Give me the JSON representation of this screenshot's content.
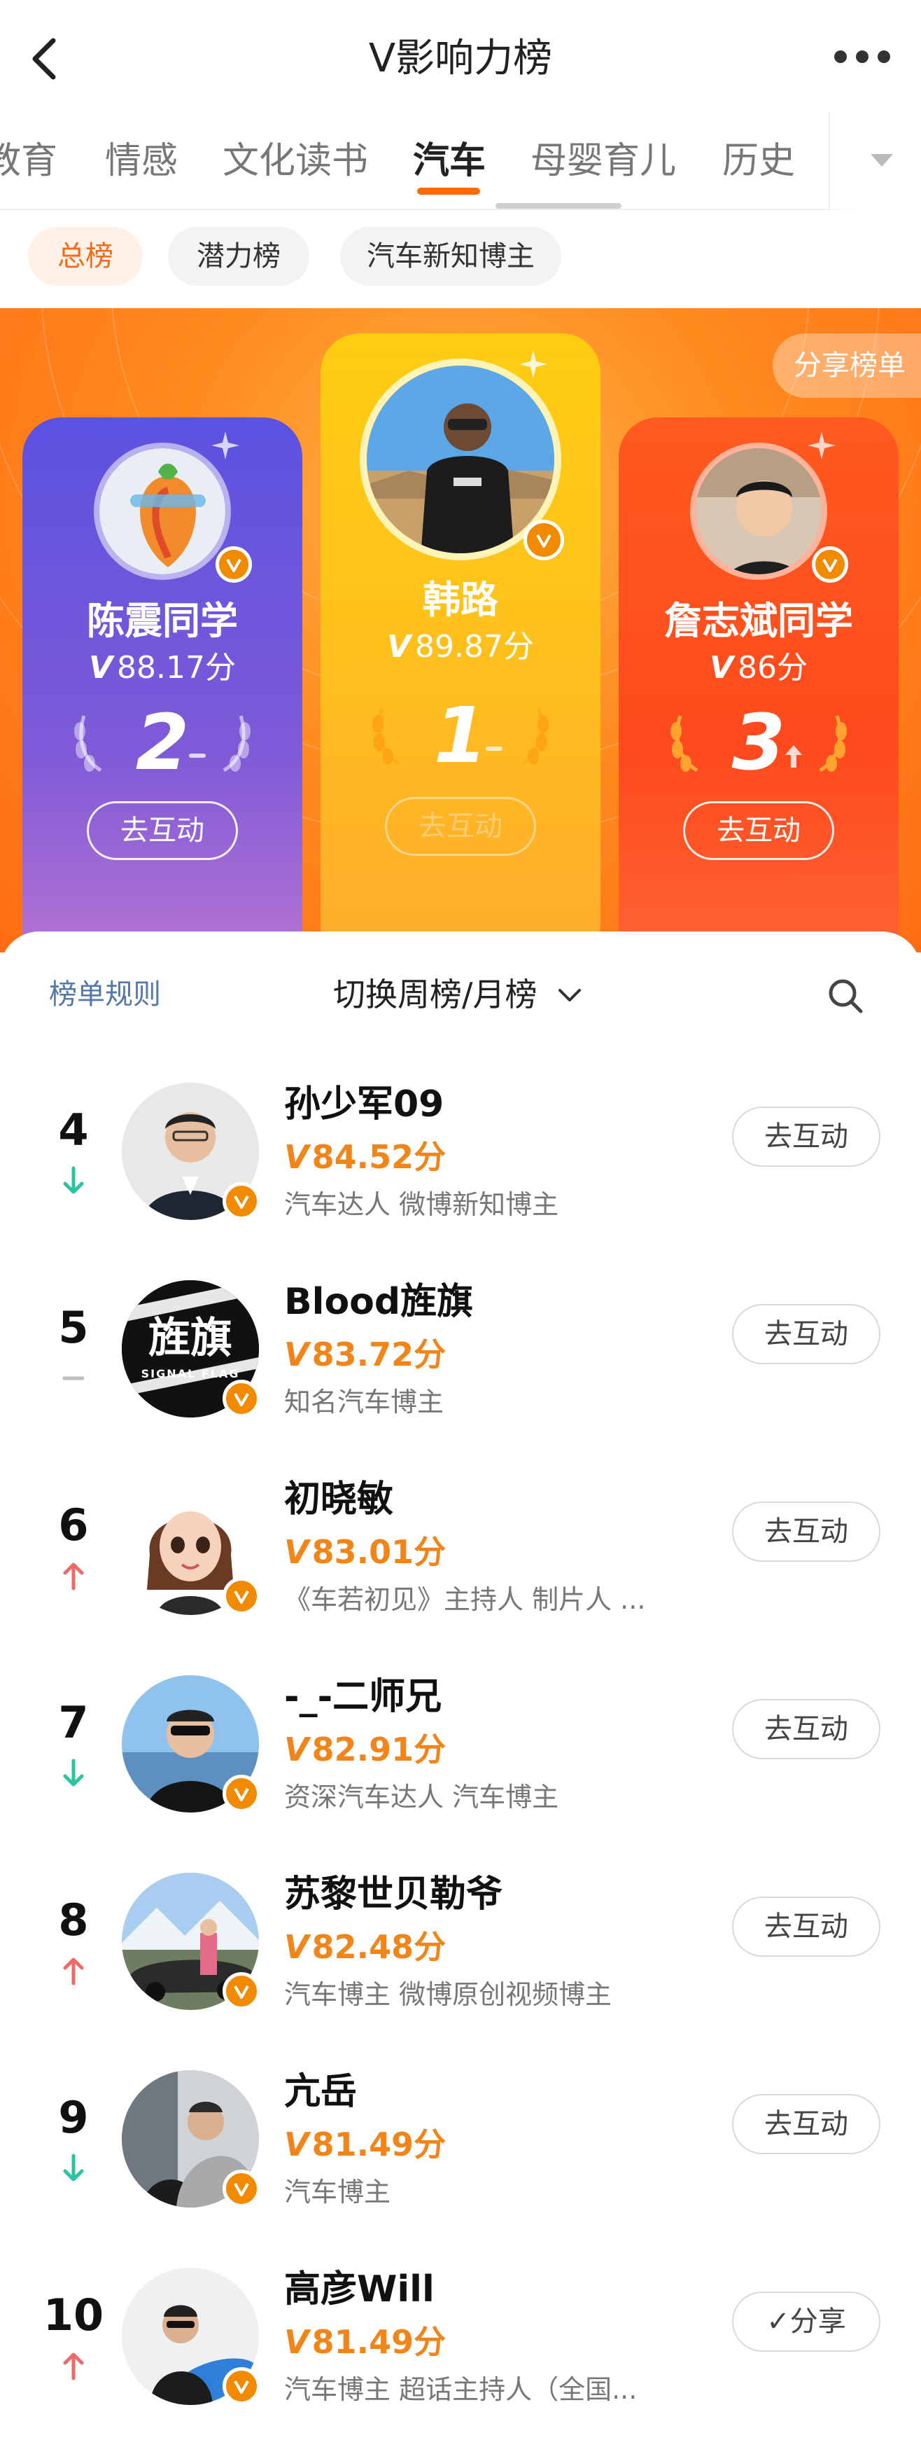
{
  "nav": {
    "title": "V影响力榜"
  },
  "tabs": [
    {
      "label": "教育"
    },
    {
      "label": "情感"
    },
    {
      "label": "文化读书"
    },
    {
      "label": "汽车"
    },
    {
      "label": "母婴育儿"
    },
    {
      "label": "历史"
    }
  ],
  "active_tab": "汽车",
  "chips": [
    {
      "label": "总榜"
    },
    {
      "label": "潜力榜"
    },
    {
      "label": "汽车新知博主"
    }
  ],
  "hero": {
    "share_label": "分享榜单",
    "podium": [
      {
        "rank": "2",
        "name": "陈震同学",
        "v_mark": "V",
        "score": "88.17分",
        "trend": "same",
        "button": "去互动"
      },
      {
        "rank": "1",
        "name": "韩路",
        "v_mark": "V",
        "score": "89.87分",
        "trend": "same",
        "button": "去互动"
      },
      {
        "rank": "3",
        "name": "詹志斌同学",
        "v_mark": "V",
        "score": "86分",
        "trend": "up",
        "button": "去互动"
      }
    ]
  },
  "list_header": {
    "rules_label": "榜单规则",
    "switch_label": "切换周榜/月榜"
  },
  "list": [
    {
      "rank": "4",
      "trend": "down",
      "name": "孙少军09",
      "v_mark": "V",
      "score": "84.52分",
      "desc": "汽车达人 微博新知博主",
      "button": "去互动"
    },
    {
      "rank": "5",
      "trend": "same",
      "name": "Blood旌旗",
      "v_mark": "V",
      "score": "83.72分",
      "desc": "知名汽车博主",
      "button": "去互动"
    },
    {
      "rank": "6",
      "trend": "up",
      "name": "初晓敏",
      "v_mark": "V",
      "score": "83.01分",
      "desc": "《车若初见》主持人 制片人 ...",
      "button": "去互动"
    },
    {
      "rank": "7",
      "trend": "down",
      "name": "-_-二师兄",
      "v_mark": "V",
      "score": "82.91分",
      "desc": "资深汽车达人 汽车博主",
      "button": "去互动"
    },
    {
      "rank": "8",
      "trend": "up",
      "name": "苏黎世贝勒爷",
      "v_mark": "V",
      "score": "82.48分",
      "desc": "汽车博主 微博原创视频博主",
      "button": "去互动"
    },
    {
      "rank": "9",
      "trend": "down",
      "name": "亢岳",
      "v_mark": "V",
      "score": "81.49分",
      "desc": "汽车博主",
      "button": "去互动"
    },
    {
      "rank": "10",
      "trend": "up",
      "name": "高彦Will",
      "v_mark": "V",
      "score": "81.49分",
      "desc": "汽车博主 超话主持人（全国...",
      "button": "✓分享"
    }
  ],
  "avatar_text": {
    "blood_logo": "旌旗",
    "blood_sub": "SIGNAL FLAG"
  },
  "colors": {
    "accent": "#ff6a00",
    "score": "#f2851a",
    "up": "#f06a6a",
    "down": "#2bc4a0",
    "badge": "#f28a00"
  }
}
